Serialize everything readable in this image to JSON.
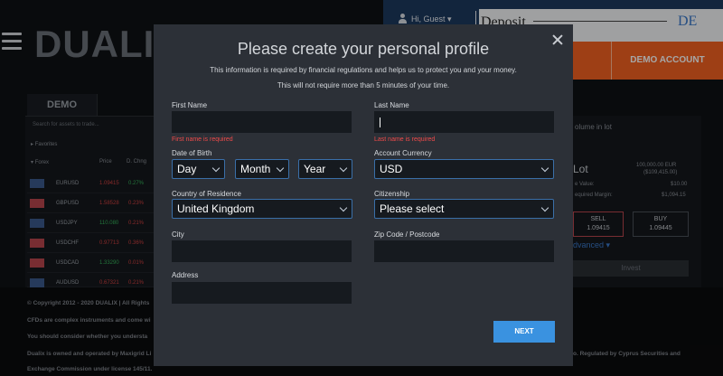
{
  "header": {
    "logo": "DUALIX",
    "user_label": "Hi, Guest ▾",
    "deposit_label": "Deposit",
    "language": "DE",
    "demo_account_label": "DEMO ACCOUNT",
    "accent_color": "#f36221"
  },
  "left_panel": {
    "tab": "DEMO",
    "search_placeholder": "Search for assets to trade...",
    "favorites": "Favorites",
    "forex": "Forex",
    "col_price": "Price",
    "col_change": "D. Chng",
    "assets": [
      {
        "name": "EURUSD",
        "price": "1.09415",
        "change": "0.27%"
      },
      {
        "name": "GBPUSD",
        "price": "1.58528",
        "change": "0.23%"
      },
      {
        "name": "USDJPY",
        "price": "110.080",
        "change": "0.21%"
      },
      {
        "name": "USDCHF",
        "price": "0.97713",
        "change": "0.36%"
      },
      {
        "name": "USDCAD",
        "price": "1.33290",
        "change": "0.01%"
      },
      {
        "name": "AUDUSD",
        "price": "0.67321",
        "change": "0.21%"
      }
    ]
  },
  "right_panel": {
    "volume_label": "olume in lot",
    "lot_label": "Lot",
    "amount": "100,000.00 EUR",
    "amount_sub": "($109,415.00)",
    "value_label": "e Value:",
    "value": "$10.00",
    "margin_label": "equired Margin:",
    "margin": "$1,094.15",
    "sell_label": "SELL",
    "sell_price": "1.09415",
    "buy_label": "BUY",
    "buy_price": "1.09445",
    "advanced_label": "dvanced ▾",
    "invest_label": "Invest"
  },
  "footer": {
    "copyright": "© Copyright 2012 - 2020 DUALIX | All Rights",
    "line2": "CFDs are complex instruments and come wi",
    "line3": "You should consider whether you understa",
    "line4": "Dualix is owned and operated by Maxigrid Li",
    "line4_right": "o. Regulated by Cyprus Securities and",
    "line5": "Exchange Commission under license 145/11."
  },
  "modal": {
    "title": "Please create your personal profile",
    "description": "This information is required by financial regulations and helps us to protect you and your money. This will not require more than 5 minutes of your time.",
    "first_name": {
      "label": "First Name",
      "value": "",
      "error": "First name is required"
    },
    "last_name": {
      "label": "Last Name",
      "value": "",
      "error": "Last name is required"
    },
    "dob": {
      "label": "Date of Birth",
      "day": "Day",
      "month": "Month",
      "year": "Year"
    },
    "currency": {
      "label": "Account Currency",
      "value": "USD"
    },
    "country": {
      "label": "Country of Residence",
      "value": "United Kingdom"
    },
    "citizenship": {
      "label": "Citizenship",
      "value": "Please select"
    },
    "city": {
      "label": "City",
      "value": ""
    },
    "zip": {
      "label": "Zip Code / Postcode",
      "value": ""
    },
    "address": {
      "label": "Address",
      "value": ""
    },
    "next_label": "NEXT",
    "error_color": "#ef4a4a",
    "button_color": "#3a92e0"
  }
}
